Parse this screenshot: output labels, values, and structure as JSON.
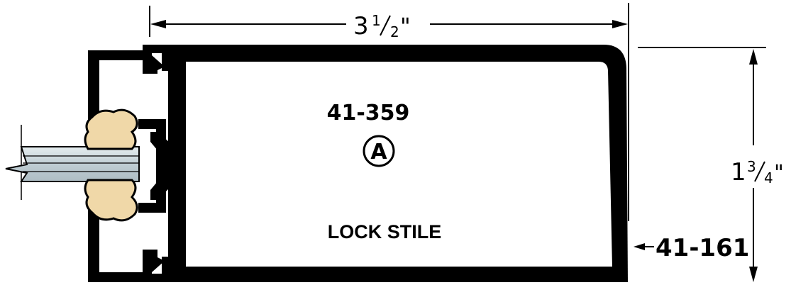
{
  "drawing": {
    "width_dimension": {
      "whole": "3",
      "numerator": "1",
      "denominator": "2",
      "unit": "\""
    },
    "height_dimension": {
      "whole": "1",
      "numerator": "3",
      "denominator": "4",
      "unit": "\""
    },
    "part_number_main": "41-359",
    "callout_letter": "A",
    "profile_label": "LOCK STILE",
    "part_number_side": "41-161"
  }
}
